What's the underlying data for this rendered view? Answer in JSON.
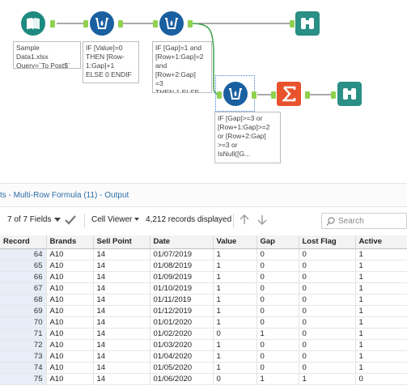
{
  "colors": {
    "tool_blue": "#1a5fa0",
    "anchor_green": "#8fd14f",
    "summarize_orange": "#e8532e",
    "browse_teal": "#2a8f85",
    "book_teal": "#1f8a7f",
    "link_blue": "#2d6ea8"
  },
  "workflow": {
    "tools": [
      {
        "name": "input-data-tool",
        "icon": "book-icon"
      },
      {
        "name": "multi-row-formula-tool-1",
        "icon": "multi-row-formula-icon"
      },
      {
        "name": "multi-row-formula-tool-2",
        "icon": "multi-row-formula-icon"
      },
      {
        "name": "browse-tool-1",
        "icon": "binoculars-icon"
      },
      {
        "name": "multi-row-formula-tool-3",
        "icon": "multi-row-formula-icon"
      },
      {
        "name": "summarize-tool",
        "icon": "sigma-icon"
      },
      {
        "name": "browse-tool-2",
        "icon": "binoculars-icon"
      }
    ],
    "annotations": {
      "input": "Sample\nData1.xlsx\nQuery=`To Post$`",
      "formula1": "IF [Value]=0\nTHEN [Row-\n1:Gap]+1\nELSE 0 ENDIF",
      "formula2": "IF [Gap]=1 and\n[Row+1:Gap]=2\nand [Row+2:Gap]\n=3\nTHEN 1 ELSE 0...",
      "formula3": "IF [Gap]>=3 or\n[Row+1:Gap]>=2\nor [Row+2:Gap]\n>=3 or\nIsNull([G..."
    }
  },
  "results": {
    "title": "ts - Multi-Row Formula (11) - Output",
    "fields_label": "7 of 7 Fields",
    "cell_viewer_label": "Cell Viewer",
    "records_label": "4,212 records displayed",
    "search_placeholder": "Search",
    "columns": [
      "Record",
      "Brands",
      "Sell Point",
      "Date",
      "Value",
      "Gap",
      "Lost Flag",
      "Active"
    ],
    "rows": [
      [
        "64",
        "A10",
        "14",
        "01/07/2019",
        "1",
        "0",
        "0",
        "1"
      ],
      [
        "65",
        "A10",
        "14",
        "01/08/2019",
        "1",
        "0",
        "0",
        "1"
      ],
      [
        "66",
        "A10",
        "14",
        "01/09/2019",
        "1",
        "0",
        "0",
        "1"
      ],
      [
        "67",
        "A10",
        "14",
        "01/10/2019",
        "1",
        "0",
        "0",
        "1"
      ],
      [
        "68",
        "A10",
        "14",
        "01/11/2019",
        "1",
        "0",
        "0",
        "1"
      ],
      [
        "69",
        "A10",
        "14",
        "01/12/2019",
        "1",
        "0",
        "0",
        "1"
      ],
      [
        "70",
        "A10",
        "14",
        "01/01/2020",
        "1",
        "0",
        "0",
        "1"
      ],
      [
        "71",
        "A10",
        "14",
        "01/02/2020",
        "0",
        "1",
        "0",
        "1"
      ],
      [
        "72",
        "A10",
        "14",
        "01/03/2020",
        "1",
        "0",
        "0",
        "1"
      ],
      [
        "73",
        "A10",
        "14",
        "01/04/2020",
        "1",
        "0",
        "0",
        "1"
      ],
      [
        "74",
        "A10",
        "14",
        "01/05/2020",
        "1",
        "0",
        "0",
        "1"
      ],
      [
        "75",
        "A10",
        "14",
        "01/06/2020",
        "0",
        "1",
        "1",
        "0"
      ]
    ]
  }
}
